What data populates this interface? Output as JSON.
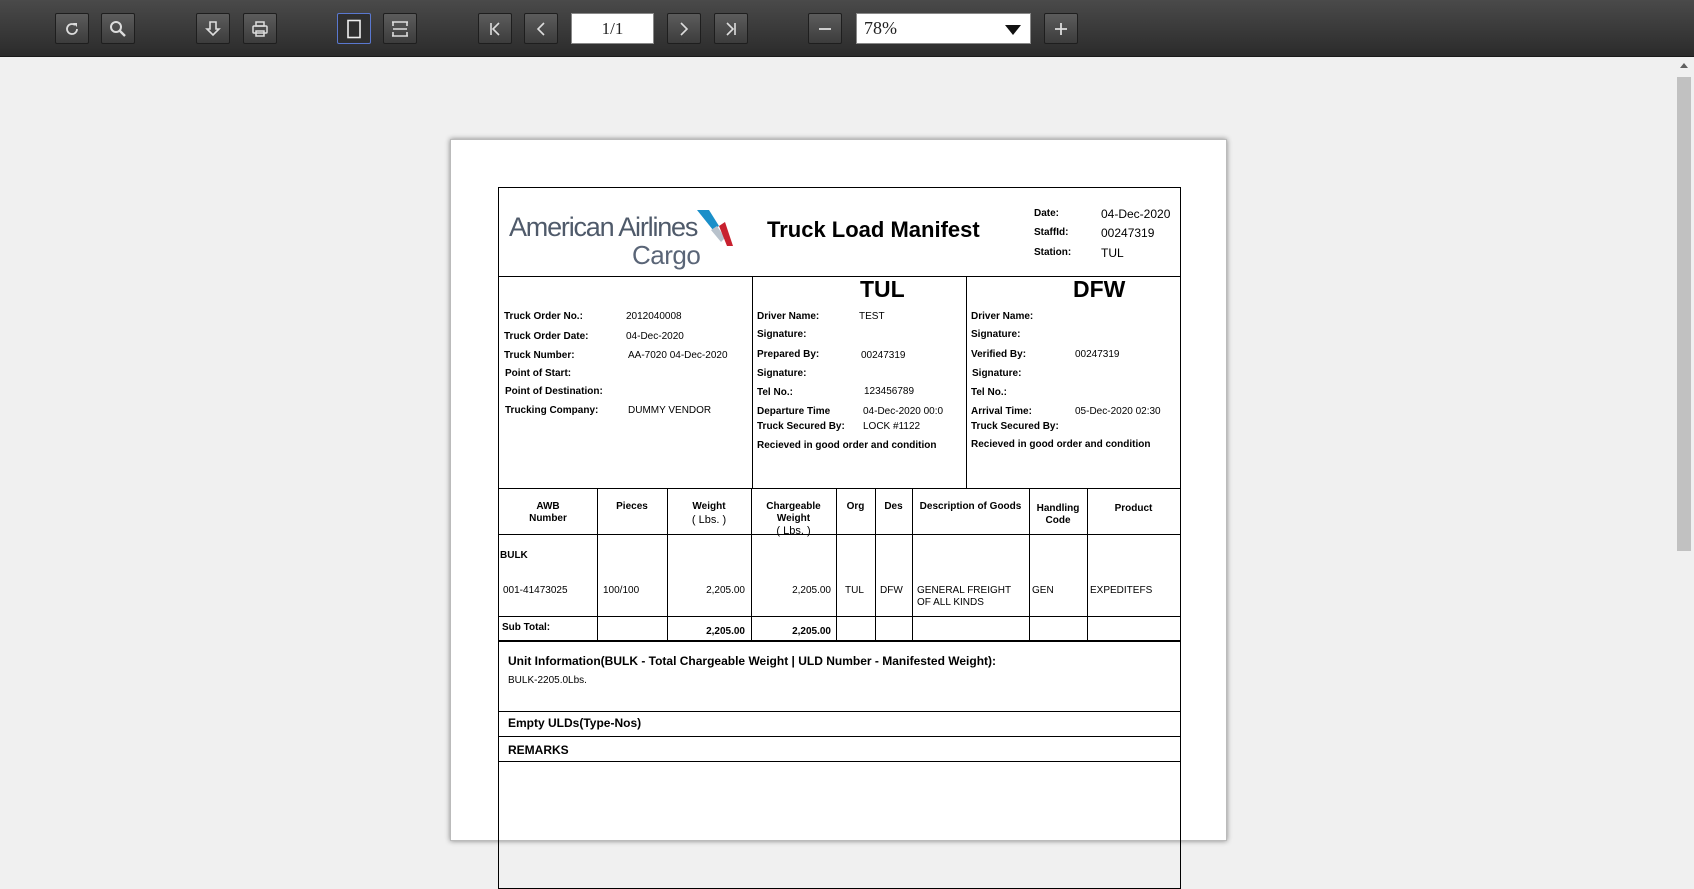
{
  "toolbar": {
    "page_indicator": "1/1",
    "zoom": "78%",
    "icons": [
      "refresh-icon",
      "search-icon",
      "download-icon",
      "print-icon",
      "single-page-icon",
      "fit-width-icon",
      "first-page-icon",
      "prev-page-icon",
      "next-page-icon",
      "last-page-icon",
      "zoom-out-icon",
      "zoom-in-icon"
    ]
  },
  "document": {
    "logo": {
      "line1": "American Airlines",
      "line2": "Cargo"
    },
    "title": "Truck Load Manifest",
    "meta": {
      "date_label": "Date:",
      "date": "04-Dec-2020",
      "staff_label": "StaffId:",
      "staff": "00247319",
      "station_label": "Station:",
      "station": "TUL"
    },
    "truck": {
      "order_no_label": "Truck Order No.:",
      "order_no": "2012040008",
      "order_date_label": "Truck Order Date:",
      "order_date": "04-Dec-2020",
      "number_label": "Truck Number:",
      "number": "AA-7020 04-Dec-2020",
      "start_label": "Point of Start:",
      "dest_label": "Point of Destination:",
      "company_label": "Trucking Company:",
      "company": "DUMMY VENDOR"
    },
    "origin": {
      "code": "TUL",
      "driver_label": "Driver Name:",
      "driver": "TEST",
      "sig1_label": "Signature:",
      "prepared_label": "Prepared By:",
      "prepared": "00247319",
      "sig2_label": "Signature:",
      "tel_label": "Tel No.:",
      "tel": "123456789",
      "departure_label": "Departure Time",
      "departure": "04-Dec-2020 00:0",
      "secured_label": "Truck Secured By:",
      "secured": "LOCK #1122",
      "received": "Recieved in good order and condition"
    },
    "destination": {
      "code": "DFW",
      "driver_label": "Driver Name:",
      "sig1_label": "Signature:",
      "verified_label": "Verified By:",
      "verified": "00247319",
      "sig2_label": "Signature:",
      "tel_label": "Tel No.:",
      "arrival_label": "Arrival Time:",
      "arrival": "05-Dec-2020 02:30",
      "secured_label": "Truck Secured By:",
      "received": "Recieved in good order and condition"
    },
    "table": {
      "headers": {
        "awb1": "AWB",
        "awb2": "Number",
        "pieces": "Pieces",
        "weight1": "Weight",
        "weight2": "( Lbs. )",
        "charge1": "Chargeable",
        "charge2": "Weight",
        "charge3": "( Lbs. )",
        "org": "Org",
        "des": "Des",
        "desc": "Description of Goods",
        "hc1": "Handling",
        "hc2": "Code",
        "product": "Product"
      },
      "group": "BULK",
      "row": {
        "awb": "001-41473025",
        "pieces": "100/100",
        "weight": "2,205.00",
        "chargeable": "2,205.00",
        "org": "TUL",
        "des": "DFW",
        "desc1": "GENERAL FREIGHT",
        "desc2": "OF ALL KINDS",
        "hc": "GEN",
        "product": "EXPEDITEFS"
      },
      "subtotal_label": "Sub Total:",
      "subtotal_weight": "2,205.00",
      "subtotal_chargeable": "2,205.00"
    },
    "unit_info_title": "Unit Information(BULK - Total Chargeable Weight | ULD Number - Manifested Weight):",
    "unit_info_value": "BULK-2205.0Lbs.",
    "empty_ulds": "Empty ULDs(Type-Nos)",
    "remarks": "REMARKS"
  }
}
